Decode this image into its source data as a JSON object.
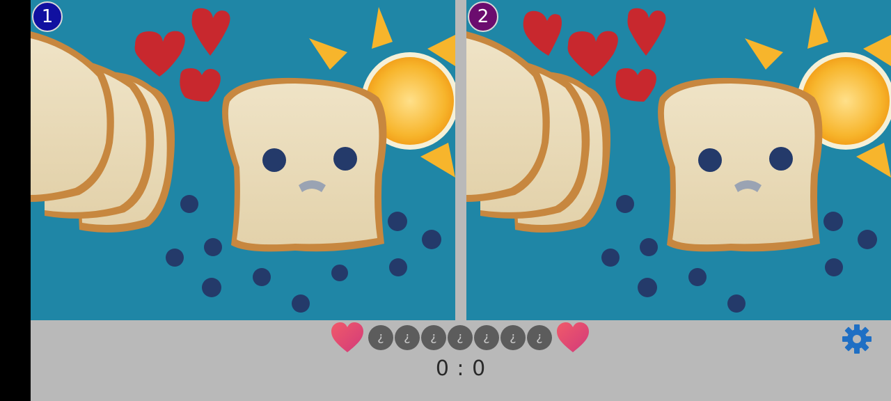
{
  "panels": [
    {
      "badge_number": "1",
      "badge_color": "#1010a0"
    },
    {
      "badge_number": "2",
      "badge_color": "#6b0c6e"
    }
  ],
  "hud": {
    "lives_left": 1,
    "lives_right": 1,
    "differences_total": 7,
    "differences_found": 0,
    "slot_glyph": "?",
    "heart_icon": "heart-icon",
    "score_text": "0 : 0"
  },
  "settings": {
    "icon": "gear-icon",
    "color": "#1f6fc4"
  },
  "colors": {
    "background_blue": "#1f86a6",
    "bar_gray": "#b9b9b9",
    "slot_gray": "#5c5c5c",
    "heart_pink": "#e8456b"
  }
}
